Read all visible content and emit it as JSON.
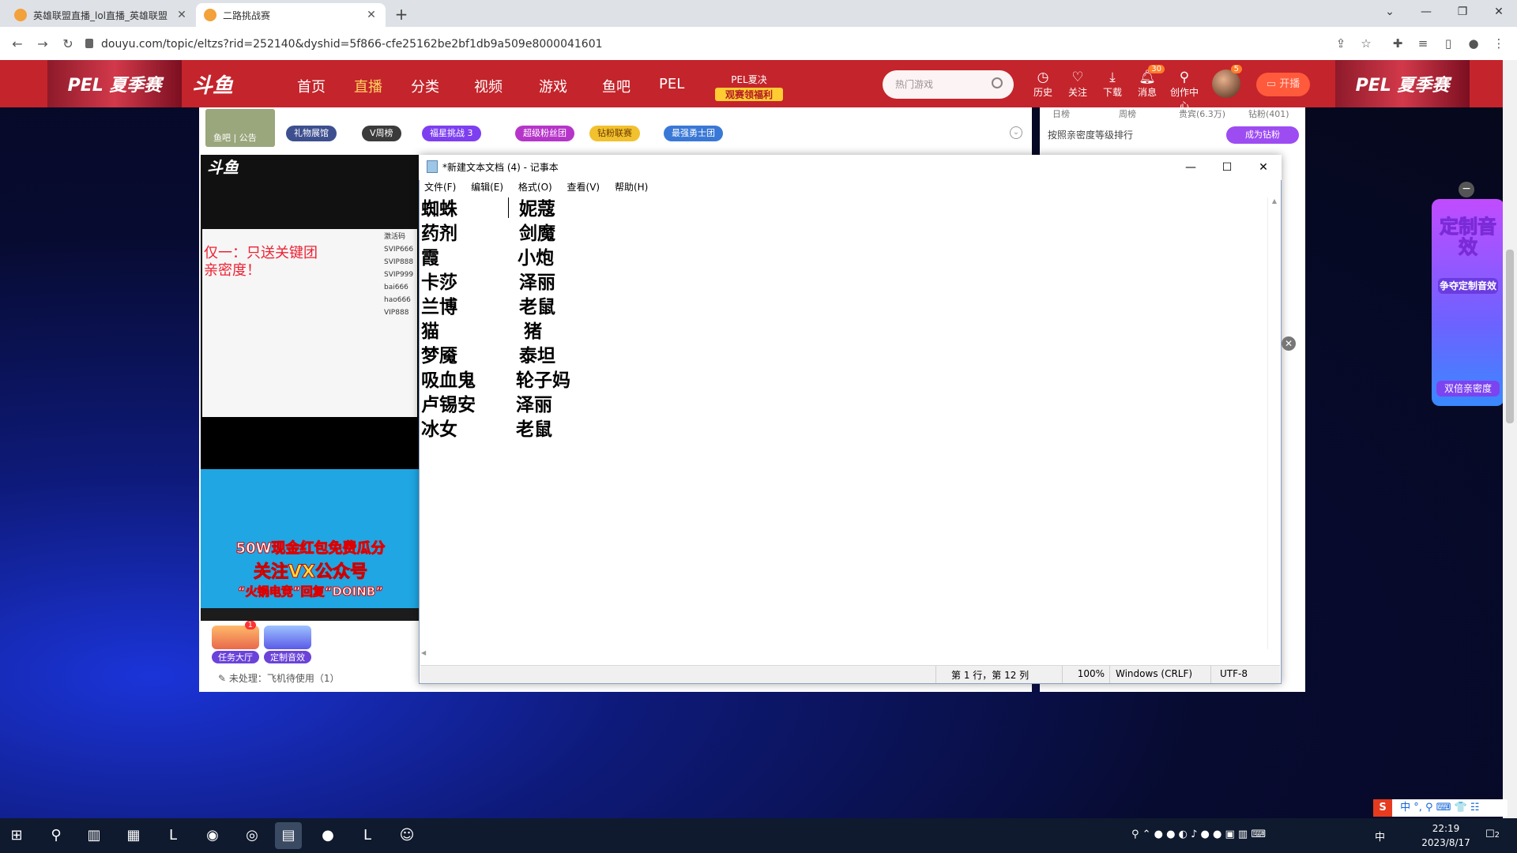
{
  "browser": {
    "tabs": [
      {
        "title": "英雄联盟直播_lol直播_英雄联盟",
        "active": false
      },
      {
        "title": "二路挑战赛",
        "active": true
      }
    ],
    "url": "douyu.com/topic/eltzs?rid=252140&dyshid=5f866-cfe25162be2bf1db9a509e8000041601"
  },
  "header": {
    "banner_left": "PEL 夏季赛",
    "banner_right": "PEL 夏季赛",
    "logo": "斗鱼",
    "nav": [
      "首页",
      "直播",
      "分类",
      "视频",
      "游戏",
      "鱼吧",
      "PEL"
    ],
    "promo_top": "PEL夏决",
    "promo_bottom": "观赛领福利",
    "search_placeholder": "热门游戏",
    "icons": [
      {
        "icon": "clock-icon",
        "label": "历史"
      },
      {
        "icon": "heart-icon",
        "label": "关注"
      },
      {
        "icon": "download-icon",
        "label": "下载"
      },
      {
        "icon": "bell-icon",
        "label": "消息",
        "badge": "30"
      },
      {
        "icon": "bulb-icon",
        "label": "创作中心"
      }
    ],
    "avatar_badge": "5",
    "start_live": "开播"
  },
  "stream_info": {
    "avatar_tags": "鱼吧 | 公告",
    "pills": [
      "礼物展馆",
      "V周榜",
      "福星挑战 3",
      "超级粉丝团",
      "钻粉联赛",
      "最强勇士团"
    ]
  },
  "right_panel": {
    "tabs": [
      "日榜",
      "周榜",
      "贵宾(6.3万)",
      "钻粉(401)"
    ],
    "rank_label": "按照亲密度等级排行",
    "diamond_button": "成为钻粉"
  },
  "video": {
    "overlay_red": [
      "仅一：只送关键团",
      "亲密度！"
    ],
    "code_list": [
      "激活码",
      "SVIP666",
      "SVIP888",
      "SVIP999",
      "bai666",
      "hao666",
      "VIP888"
    ],
    "banner_line1": "50W现金红包免费瓜分",
    "banner_line2": "关注VX公众号",
    "banner_line3": "“火锅电竞”回复“DOINB”"
  },
  "gifts": [
    {
      "label": "任务大厅",
      "badge": "1"
    },
    {
      "label": "定制音效"
    }
  ],
  "pending": "未处理：飞机待使用（1）",
  "notepad": {
    "title": "*新建文本文档 (4) - 记事本",
    "menu": [
      "文件(F)",
      "编辑(E)",
      "格式(O)",
      "查看(V)",
      "帮助(H)"
    ],
    "left_col": [
      "蜘蛛",
      "药剂",
      "霞",
      "卡莎",
      "兰博",
      "猫",
      "梦魇",
      "吸血鬼",
      "卢锡安",
      "冰女"
    ],
    "right_col": [
      "妮蔻",
      "剑魔",
      "小炮",
      "泽丽",
      "老鼠",
      "猪",
      "泰坦",
      "轮子妈",
      "泽丽",
      "老鼠"
    ],
    "status": {
      "position": "第 1 行，第 12 列",
      "zoom": "100%",
      "eol": "Windows (CRLF)",
      "encoding": "UTF-8"
    }
  },
  "float_widget": {
    "title": "定制音效",
    "sub": "争夺定制音效",
    "bottom": "双倍亲密度"
  },
  "taskbar": {
    "time": "22:19",
    "date": "2023/8/17",
    "ime": "中",
    "notification_count": "2"
  }
}
